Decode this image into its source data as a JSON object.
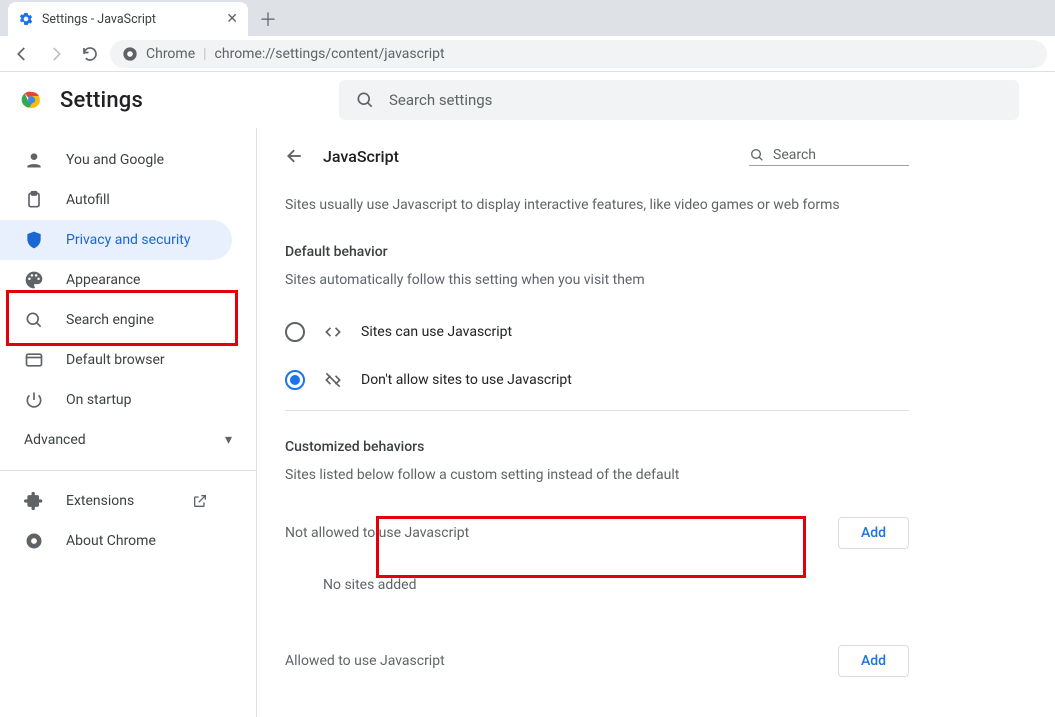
{
  "browser": {
    "tab_title": "Settings - JavaScript",
    "url_prefix": "Chrome",
    "url": "chrome://settings/content/javascript"
  },
  "header": {
    "title": "Settings",
    "search_placeholder": "Search settings"
  },
  "sidebar": {
    "items": [
      {
        "label": "You and Google"
      },
      {
        "label": "Autofill"
      },
      {
        "label": "Privacy and security"
      },
      {
        "label": "Appearance"
      },
      {
        "label": "Search engine"
      },
      {
        "label": "Default browser"
      },
      {
        "label": "On startup"
      }
    ],
    "advanced": "Advanced",
    "extensions": "Extensions",
    "about": "About Chrome"
  },
  "content": {
    "title": "JavaScript",
    "search_placeholder": "Search",
    "description": "Sites usually use Javascript to display interactive features, like video games or web forms",
    "default_behavior_h": "Default behavior",
    "default_behavior_sub": "Sites automatically follow this setting when you visit them",
    "radio_allow": "Sites can use Javascript",
    "radio_block": "Don't allow sites to use Javascript",
    "custom_h": "Customized behaviors",
    "custom_sub": "Sites listed below follow a custom setting instead of the default",
    "not_allowed_h": "Not allowed to use Javascript",
    "no_sites": "No sites added",
    "allowed_h": "Allowed to use Javascript",
    "add_label": "Add"
  }
}
